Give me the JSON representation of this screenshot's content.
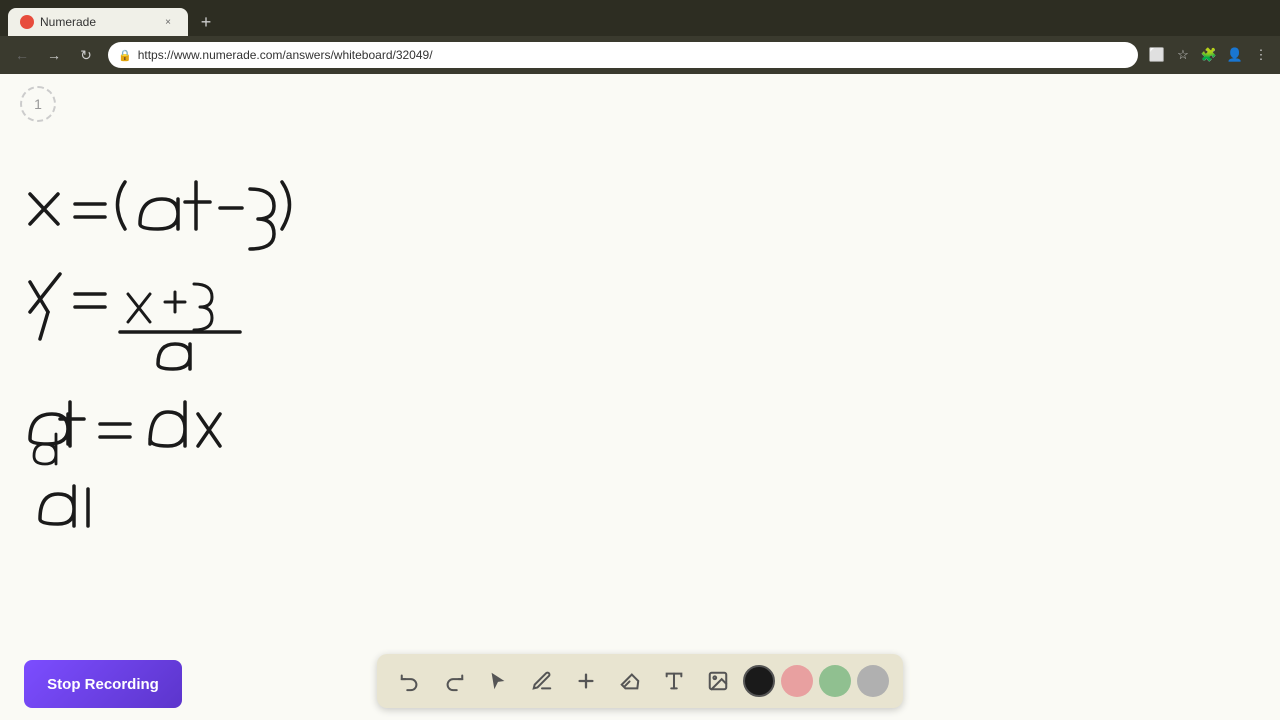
{
  "browser": {
    "tab_title": "Numerade",
    "tab_favicon": "N",
    "url": "https://www.numerade.com/answers/whiteboard/32049/",
    "new_tab_label": "+",
    "close_tab_label": "×"
  },
  "toolbar": {
    "stop_recording_label": "Stop Recording",
    "tools": [
      {
        "id": "undo",
        "label": "↺",
        "name": "undo"
      },
      {
        "id": "redo",
        "label": "↻",
        "name": "redo"
      },
      {
        "id": "select",
        "label": "▲",
        "name": "select"
      },
      {
        "id": "pen",
        "label": "✏",
        "name": "pen"
      },
      {
        "id": "add",
        "label": "+",
        "name": "add"
      },
      {
        "id": "eraser",
        "label": "◈",
        "name": "eraser"
      },
      {
        "id": "text",
        "label": "A",
        "name": "text"
      },
      {
        "id": "image",
        "label": "🖼",
        "name": "image"
      }
    ],
    "colors": [
      {
        "id": "black",
        "hex": "#1a1a1a",
        "name": "black-color"
      },
      {
        "id": "pink",
        "hex": "#e8a0a0",
        "name": "pink-color"
      },
      {
        "id": "green",
        "hex": "#90c090",
        "name": "green-color"
      },
      {
        "id": "gray",
        "hex": "#b0b0b0",
        "name": "gray-color"
      }
    ]
  },
  "page": {
    "number": "1",
    "background_color": "#fafaf5"
  },
  "math_content": {
    "line1": "x = (at-3)",
    "line2": "y = (x+3)/a",
    "line3": "a_dt = dx",
    "line4": "d|"
  }
}
